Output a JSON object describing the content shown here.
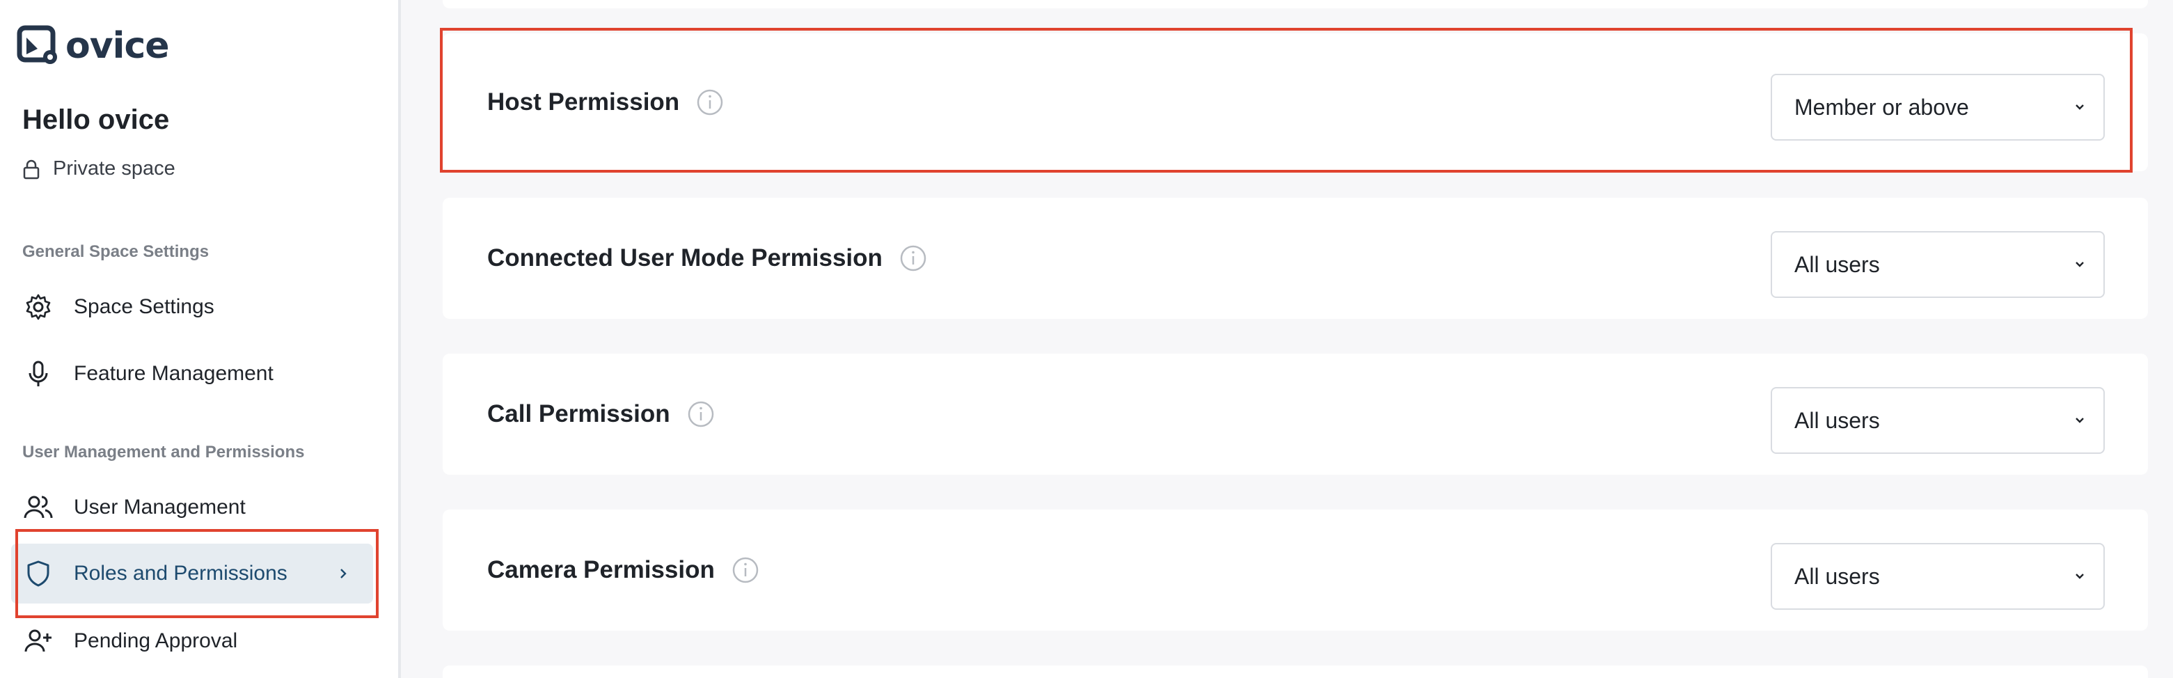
{
  "sidebar": {
    "logo_text": "ovice",
    "space_name": "Hello ovice",
    "space_type": "Private space",
    "sections": [
      {
        "label": "General Space Settings",
        "items": [
          {
            "label": "Space Settings",
            "icon": "gear-icon"
          },
          {
            "label": "Feature Management",
            "icon": "microphone-icon"
          }
        ]
      },
      {
        "label": "User Management and Permissions",
        "items": [
          {
            "label": "User Management",
            "icon": "users-icon"
          },
          {
            "label": "Roles and Permissions",
            "icon": "shield-icon",
            "active": true
          },
          {
            "label": "Pending Approval",
            "icon": "user-plus-icon"
          }
        ]
      }
    ]
  },
  "permissions": [
    {
      "title": "Host Permission",
      "value": "Member or above"
    },
    {
      "title": "Connected User Mode Permission",
      "value": "All users"
    },
    {
      "title": "Call Permission",
      "value": "All users"
    },
    {
      "title": "Camera Permission",
      "value": "All users"
    }
  ],
  "colors": {
    "accent": "#1d4a6e",
    "highlight": "#e0432f",
    "active_bg": "#e6ecf1",
    "background": "#f7f7f9"
  }
}
